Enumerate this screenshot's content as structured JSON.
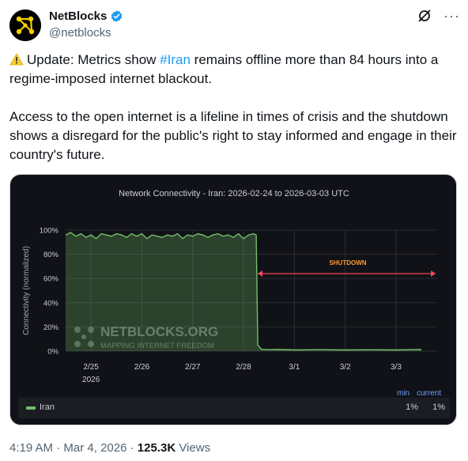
{
  "author": {
    "display_name": "NetBlocks",
    "handle": "@netblocks"
  },
  "tweet": {
    "line1_pre": "Update: Metrics show ",
    "hashtag": "#Iran",
    "line1_post": " remains offline more than 84 hours into a regime-imposed internet blackout.",
    "paragraph2": "Access to the open internet is a lifeline in times of crisis and the shutdown shows a disregard for the public's right to stay informed and engage in their country's future."
  },
  "meta": {
    "time": "4:19 AM",
    "sep1": " · ",
    "date": "Mar 4, 2026",
    "sep2": " · ",
    "views_count": "125.3K",
    "views_label": " Views"
  },
  "colors": {
    "series": "#73bf69",
    "annotation": "#f2495c",
    "annotation_text": "#ff9830",
    "legend_header": "#6e9fff",
    "link": "#1d9bf0"
  },
  "icons": {
    "avatar": "netblocks-logo",
    "verified": "verified-badge-icon",
    "grok": "grok-icon",
    "more": "more-icon",
    "warning": "warning-icon"
  },
  "chart_data": {
    "type": "area",
    "title": "Network Connectivity - Iran: 2026-02-24 to 2026-03-03 UTC",
    "xlabel": "",
    "ylabel": "Connectivity (normalized)",
    "y_ticks": [
      "100%",
      "80%",
      "60%",
      "40%",
      "20%",
      "0%"
    ],
    "ylim": [
      0,
      100
    ],
    "x_ticks": [
      "2/25",
      "2/26",
      "2/27",
      "2/28",
      "3/1",
      "3/2",
      "3/3"
    ],
    "x_year_label": "2026",
    "grid": true,
    "watermark": [
      "NETBLOCKS.ORG",
      "MAPPING INTERNET FREEDOM"
    ],
    "annotation": {
      "label": "SHUTDOWN",
      "x_start": "2/28",
      "x_end": "3/3+"
    },
    "series": [
      {
        "name": "Iran",
        "x_days": [
          0,
          0.1,
          0.2,
          0.3,
          0.4,
          0.5,
          0.6,
          0.7,
          0.8,
          0.9,
          1.0,
          1.1,
          1.2,
          1.3,
          1.4,
          1.5,
          1.6,
          1.7,
          1.8,
          1.9,
          2.0,
          2.1,
          2.2,
          2.3,
          2.4,
          2.5,
          2.6,
          2.7,
          2.8,
          2.9,
          3.0,
          3.1,
          3.2,
          3.3,
          3.4,
          3.5,
          3.6,
          3.7,
          3.75,
          3.78,
          3.85,
          4.0,
          4.2,
          4.5,
          5.0,
          5.5,
          6.0,
          6.5,
          7.0
        ],
        "values": [
          96,
          98,
          95,
          97,
          94,
          96,
          93,
          97,
          96,
          95,
          97,
          96,
          94,
          97,
          95,
          97,
          93,
          96,
          95,
          94,
          96,
          95,
          97,
          93,
          96,
          95,
          97,
          96,
          94,
          96,
          97,
          95,
          96,
          94,
          97,
          93,
          96,
          97,
          96,
          5,
          1.5,
          1.2,
          1.3,
          1.0,
          1.2,
          1.0,
          1.1,
          1.0,
          1.3
        ]
      }
    ],
    "legend": {
      "placement": "bottom",
      "columns": [
        "min",
        "current"
      ],
      "rows": [
        {
          "name": "Iran",
          "min": "1%",
          "current": "1%"
        }
      ]
    }
  }
}
